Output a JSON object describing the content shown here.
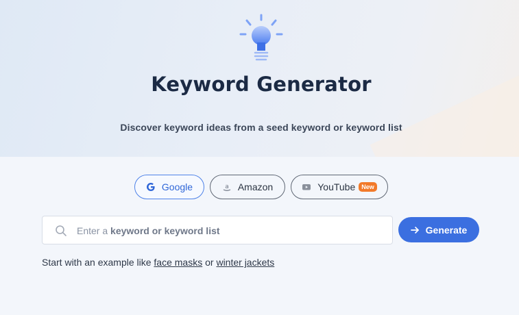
{
  "hero": {
    "title": "Keyword Generator",
    "subtitle": "Discover keyword ideas from a seed keyword or keyword list"
  },
  "sources": [
    {
      "label": "Google",
      "icon": "google-icon",
      "active": true
    },
    {
      "label": "Amazon",
      "icon": "amazon-icon",
      "active": false
    },
    {
      "label": "YouTube",
      "icon": "youtube-icon",
      "active": false,
      "badge": "New"
    }
  ],
  "search": {
    "placeholder_prefix": "Enter a ",
    "placeholder_bold": "keyword or keyword list",
    "value": ""
  },
  "generate_label": "Generate",
  "examples": {
    "prefix": "Start with an example like ",
    "first": "face masks",
    "middle": " or ",
    "second": "winter jackets"
  },
  "colors": {
    "accent": "#3b6fe0",
    "badge": "#f27a2a",
    "title": "#1b2a44"
  }
}
